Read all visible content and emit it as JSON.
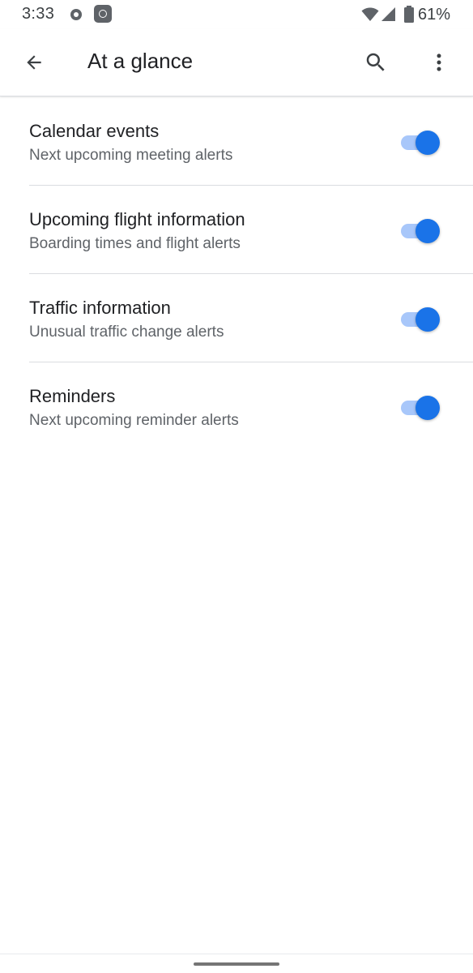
{
  "status_bar": {
    "time": "3:33",
    "battery_percent": "61%",
    "icons": [
      "notification-dot-icon",
      "app-notification-icon",
      "wifi-icon",
      "cell-signal-icon",
      "battery-icon"
    ]
  },
  "app_bar": {
    "title": "At a glance",
    "icons": [
      "back-arrow-icon",
      "search-icon",
      "more-vert-icon"
    ]
  },
  "settings": [
    {
      "title": "Calendar events",
      "summary": "Next upcoming meeting alerts",
      "enabled": true
    },
    {
      "title": "Upcoming flight information",
      "summary": "Boarding times and flight alerts",
      "enabled": true
    },
    {
      "title": "Traffic information",
      "summary": "Unusual traffic change alerts",
      "enabled": true
    },
    {
      "title": "Reminders",
      "summary": "Next upcoming reminder alerts",
      "enabled": true
    }
  ],
  "colors": {
    "accent": "#1a73e8",
    "track_on": "#a8c7fa",
    "primary_text": "#202124",
    "secondary_text": "#5f6368"
  }
}
